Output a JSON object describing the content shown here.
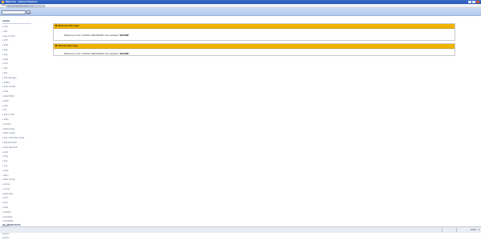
{
  "window": {
    "title": "Welcome - Internet Explorer",
    "address_label": "Addr",
    "address": "http://localhost/welcome.asp"
  },
  "search": {
    "value": "",
    "go_label": "Go"
  },
  "sidebar": {
    "title": "Admin",
    "items": [
      {
        "label": "User"
      },
      {
        "label": "Site"
      },
      {
        "label": "Site CLASS"
      },
      {
        "label": "FTP"
      },
      {
        "label": "DNS"
      },
      {
        "label": "Mail"
      },
      {
        "label": "SQL"
      },
      {
        "label": "ASP"
      },
      {
        "label": "CGI"
      },
      {
        "label": "SSL"
      },
      {
        "label": "SSI"
      },
      {
        "label": "SSL Manager"
      },
      {
        "label": "DNS2"
      },
      {
        "label": "SQL CLASS"
      },
      {
        "label": "PHP"
      },
      {
        "label": "Mail SPAM"
      },
      {
        "label": "WAP"
      },
      {
        "label": "JSP"
      },
      {
        "label": "IIS"
      },
      {
        "label": "SSL LT RS"
      },
      {
        "label": "DSN"
      },
      {
        "label": "VHOST"
      },
      {
        "label": "Mail Config"
      },
      {
        "label": "Web Config"
      },
      {
        "label": "Site / Add Web Config"
      },
      {
        "label": "Mail BACKUP"
      },
      {
        "label": "Web BACKUP"
      },
      {
        "label": "Auth"
      },
      {
        "label": "Ping"
      },
      {
        "label": "Stat"
      },
      {
        "label": "Log"
      },
      {
        "label": "Task"
      },
      {
        "label": "Mem"
      },
      {
        "label": "Web Config"
      },
      {
        "label": "Admin"
      },
      {
        "label": "Group"
      },
      {
        "label": "Web Root"
      },
      {
        "label": "Proc"
      },
      {
        "label": "Port"
      },
      {
        "label": "Role"
      },
      {
        "label": "NetStat"
      },
      {
        "label": "NetAdapt"
      },
      {
        "label": "IISADMIN"
      },
      {
        "label": "ADSI"
      },
      {
        "label": "ADO ASE"
      }
    ],
    "section_title": "Sh - NEWS DATE",
    "section_items": [
      {
        "label": "WEB Server"
      },
      {
        "label": "Forum"
      },
      {
        "label": "Admin"
      }
    ]
  },
  "panels": [
    {
      "title": "Welcome Message",
      "body_prefix": "Welcome to the \"HVKSC DEVIDAND\" free website ",
      "body_strong": "\"BLEND\""
    },
    {
      "title": "Website Message",
      "body_prefix": "Welcome to the \"HVKSC DEVIDAND\" free website ",
      "body_strong": "\"BLEND\""
    }
  ],
  "statusbar": {
    "zoom": "100%",
    "arrow": "▾"
  },
  "colors": {
    "panel_header": "#f0b400",
    "top_bar": "#c9daf4",
    "title_bar": "#3a6fd0"
  }
}
